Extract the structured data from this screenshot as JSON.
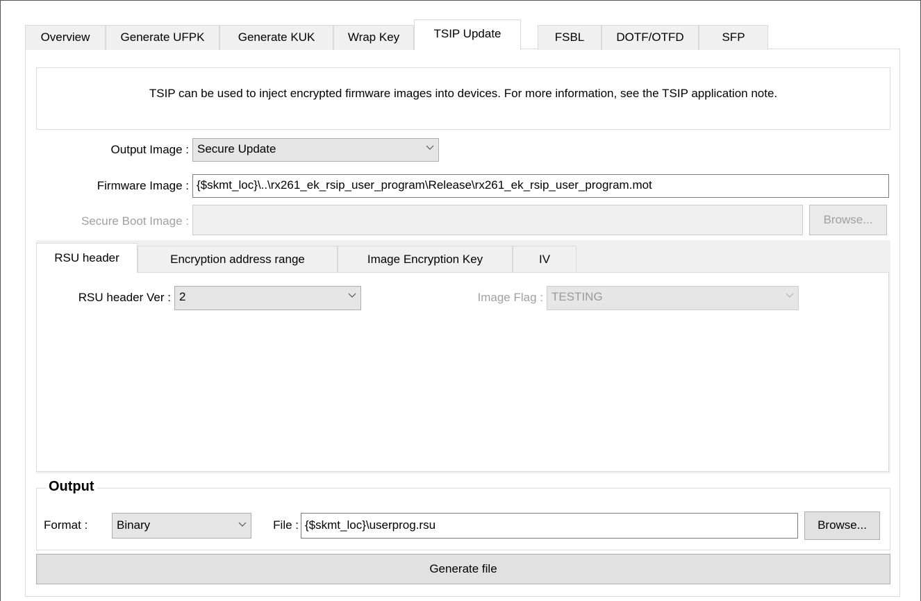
{
  "tabs": [
    "Overview",
    "Generate UFPK",
    "Generate KUK",
    "Wrap Key",
    "TSIP Update",
    "FSBL",
    "DOTF/OTFD",
    "SFP"
  ],
  "active_tab": "TSIP Update",
  "info_text": "TSIP can be used to inject encrypted firmware images into devices. For more information, see the TSIP application note.",
  "output_image": {
    "label": "Output Image :",
    "value": "Secure Update"
  },
  "firmware_image": {
    "label": "Firmware Image :",
    "value": "{$skmt_loc}\\..\\rx261_ek_rsip_user_program\\Release\\rx261_ek_rsip_user_program.mot"
  },
  "secure_boot_image": {
    "label": "Secure Boot Image :",
    "value": "",
    "browse_label": "Browse..."
  },
  "inner_tabs": [
    "RSU header",
    "Encryption address range",
    "Image Encryption Key",
    "IV"
  ],
  "rsu_header": {
    "ver_label": "RSU header Ver :",
    "ver_value": "2",
    "flag_label": "Image Flag :",
    "flag_value": "TESTING"
  },
  "output": {
    "title": "Output",
    "format_label": "Format :",
    "format_value": "Binary",
    "file_label": "File :",
    "file_value": "{$skmt_loc}\\userprog.rsu",
    "browse_label": "Browse..."
  },
  "generate_label": "Generate file"
}
